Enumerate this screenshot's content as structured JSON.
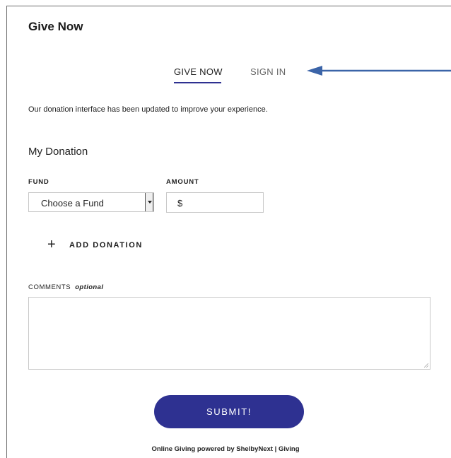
{
  "page": {
    "title": "Give Now"
  },
  "tabs": [
    {
      "label": "GIVE NOW",
      "active": true
    },
    {
      "label": "SIGN IN",
      "active": false
    }
  ],
  "notice": "Our donation interface has been updated to improve your experience.",
  "donation": {
    "section_title": "My Donation",
    "fund_label": "FUND",
    "fund_value": "Choose a Fund",
    "amount_label": "AMOUNT",
    "amount_currency": "$",
    "add_donation_icon": "+",
    "add_donation_label": "ADD DONATION"
  },
  "comments": {
    "label": "COMMENTS",
    "optional_label": "optional",
    "value": ""
  },
  "submit_label": "SUBMIT!",
  "footer": "Online Giving powered by ShelbyNext | Giving",
  "colors": {
    "accent": "#2e3191",
    "annotation_arrow": "#3b64a8"
  },
  "icons": {
    "add": "plus-icon",
    "dropdown": "dropdown-arrow-icon",
    "annotation": "annotation-arrow-icon"
  }
}
